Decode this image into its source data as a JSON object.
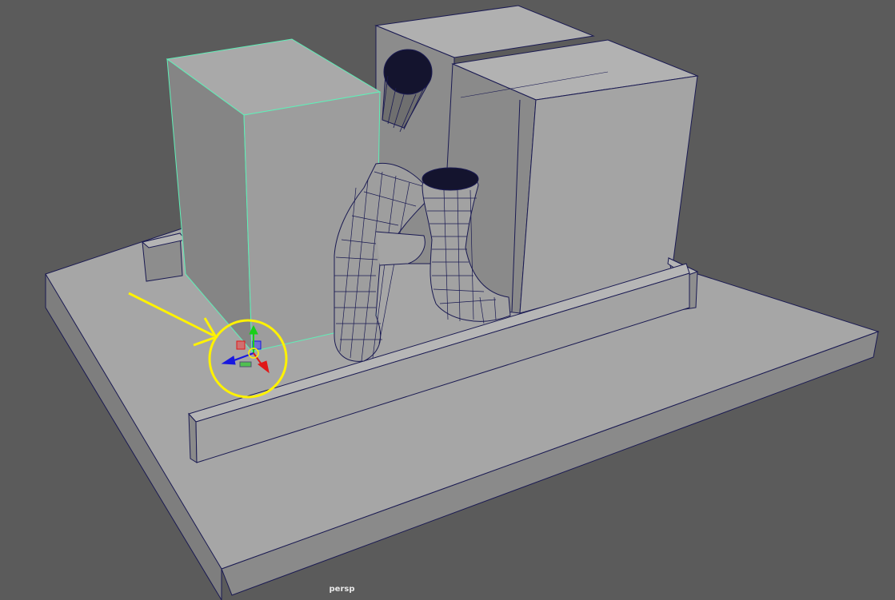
{
  "viewport": {
    "camera_label": "persp"
  },
  "colors": {
    "background": "#5b5b5b",
    "face_light": "#a8a8a8",
    "face_mid": "#9a9a9a",
    "face_dark": "#7d7d7d",
    "wire": "#1a1a52",
    "selection_outline": "#5ff0b8",
    "annotation": "#fff200",
    "gizmo_x": "#e01818",
    "gizmo_y": "#18d018",
    "gizmo_z": "#1818e0"
  },
  "scene": {
    "objects": [
      "base-plate",
      "rail-front",
      "rail-back",
      "block-selected",
      "block-back-left",
      "block-right",
      "pipe-left",
      "pipe-right",
      "pipe-upper"
    ],
    "annotation": [
      "arrow",
      "circle"
    ],
    "manipulator": "move-gizmo"
  }
}
